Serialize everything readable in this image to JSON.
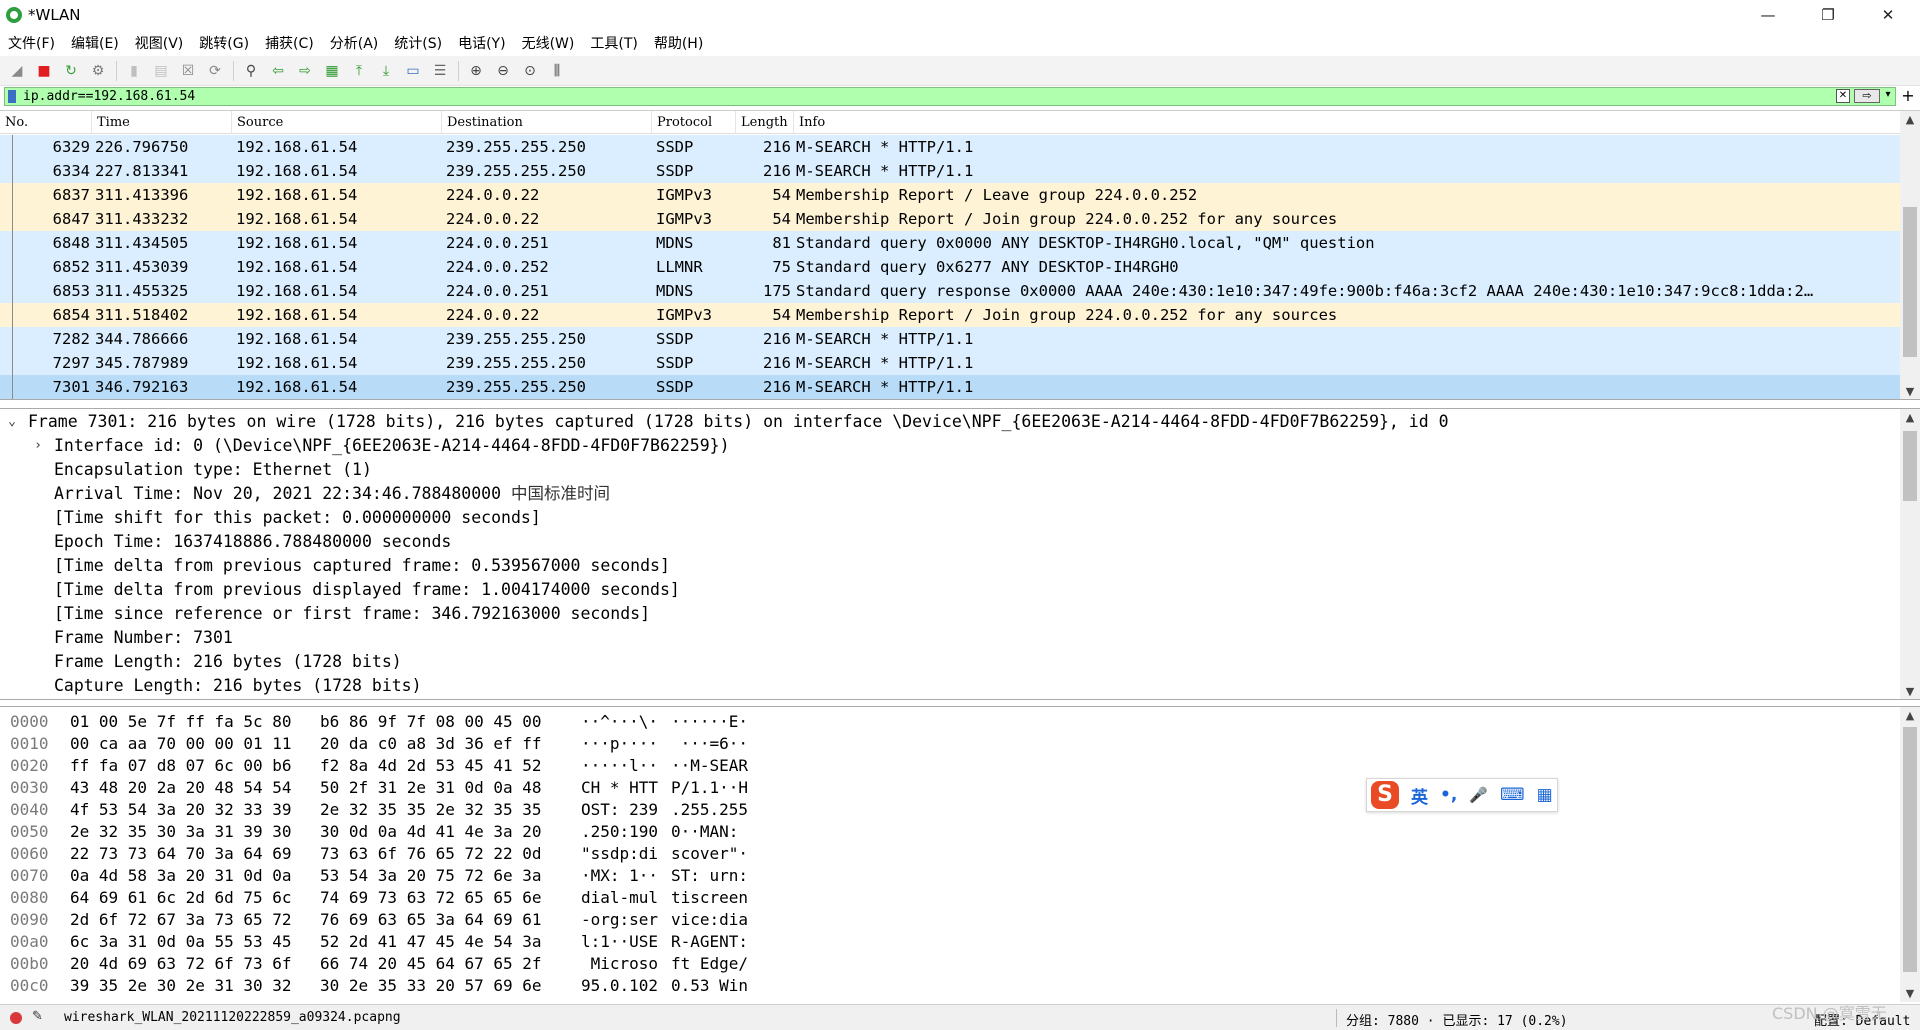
{
  "window": {
    "title": "*WLAN",
    "controls": {
      "minimize": "—",
      "maximize": "❐",
      "close": "✕"
    }
  },
  "menu": [
    "文件(F)",
    "编辑(E)",
    "视图(V)",
    "跳转(G)",
    "捕获(C)",
    "分析(A)",
    "统计(S)",
    "电话(Y)",
    "无线(W)",
    "工具(T)",
    "帮助(H)"
  ],
  "toolbar": [
    {
      "icon": "shark-fin-start-icon",
      "glyph": "◢",
      "color": "#8a8a8a"
    },
    {
      "icon": "stop-capture-icon",
      "glyph": "■",
      "color": "#e11d1d"
    },
    {
      "icon": "restart-capture-icon",
      "glyph": "↻",
      "color": "#3aa13a"
    },
    {
      "icon": "capture-options-icon",
      "glyph": "⚙",
      "color": "#777777"
    },
    {
      "icon": "open-file-icon",
      "glyph": "▮",
      "color": "#bfbfbf"
    },
    {
      "icon": "save-file-icon",
      "glyph": "▤",
      "color": "#bfbfbf"
    },
    {
      "icon": "close-file-icon",
      "glyph": "☒",
      "color": "#888888"
    },
    {
      "icon": "reload-file-icon",
      "glyph": "⟳",
      "color": "#888888"
    },
    {
      "icon": "find-packet-icon",
      "glyph": "⚲",
      "color": "#444444"
    },
    {
      "icon": "go-back-icon",
      "glyph": "⇦",
      "color": "#2f9a2f"
    },
    {
      "icon": "go-forward-icon",
      "glyph": "⇨",
      "color": "#2f9a2f"
    },
    {
      "icon": "go-to-packet-icon",
      "glyph": "▦",
      "color": "#2f9a2f"
    },
    {
      "icon": "first-packet-icon",
      "glyph": "⤒",
      "color": "#2f9a2f"
    },
    {
      "icon": "last-packet-icon",
      "glyph": "⤓",
      "color": "#2f9a2f"
    },
    {
      "icon": "autoscroll-icon",
      "glyph": "▭",
      "color": "#3a6fc4"
    },
    {
      "icon": "colorize-icon",
      "glyph": "☰",
      "color": "#666666"
    },
    {
      "icon": "zoom-in-icon",
      "glyph": "⊕",
      "color": "#444444"
    },
    {
      "icon": "zoom-out-icon",
      "glyph": "⊖",
      "color": "#444444"
    },
    {
      "icon": "zoom-normal-icon",
      "glyph": "⊙",
      "color": "#444444"
    },
    {
      "icon": "resize-columns-icon",
      "glyph": "⫼",
      "color": "#444444"
    }
  ],
  "filter": {
    "value": "ip.addr==192.168.61.54",
    "clear_glyph": "✕",
    "apply_glyph": "⇨",
    "dropdown_glyph": "▾",
    "add_glyph": "+",
    "bg_color": "#afffaf"
  },
  "packet_list": {
    "columns": [
      "No.",
      "Time",
      "Source",
      "Destination",
      "Protocol",
      "Length",
      "Info"
    ],
    "colors": {
      "ssdp": "#daeeff",
      "igmp": "#fff3d6",
      "selected": "#b8dcf8"
    },
    "rows": [
      {
        "no": "6329",
        "time": "226.796750",
        "src": "192.168.61.54",
        "dst": "239.255.255.250",
        "proto": "SSDP",
        "len": "216",
        "info": "M-SEARCH * HTTP/1.1",
        "color": "#daeeff"
      },
      {
        "no": "6334",
        "time": "227.813341",
        "src": "192.168.61.54",
        "dst": "239.255.255.250",
        "proto": "SSDP",
        "len": "216",
        "info": "M-SEARCH * HTTP/1.1",
        "color": "#daeeff"
      },
      {
        "no": "6837",
        "time": "311.413396",
        "src": "192.168.61.54",
        "dst": "224.0.0.22",
        "proto": "IGMPv3",
        "len": "54",
        "info": "Membership Report / Leave group 224.0.0.252",
        "color": "#fff3d6"
      },
      {
        "no": "6847",
        "time": "311.433232",
        "src": "192.168.61.54",
        "dst": "224.0.0.22",
        "proto": "IGMPv3",
        "len": "54",
        "info": "Membership Report / Join group 224.0.0.252 for any sources",
        "color": "#fff3d6"
      },
      {
        "no": "6848",
        "time": "311.434505",
        "src": "192.168.61.54",
        "dst": "224.0.0.251",
        "proto": "MDNS",
        "len": "81",
        "info": "Standard query 0x0000 ANY DESKTOP-IH4RGH0.local, \"QM\" question",
        "color": "#daeeff"
      },
      {
        "no": "6852",
        "time": "311.453039",
        "src": "192.168.61.54",
        "dst": "224.0.0.252",
        "proto": "LLMNR",
        "len": "75",
        "info": "Standard query 0x6277 ANY DESKTOP-IH4RGH0",
        "color": "#daeeff"
      },
      {
        "no": "6853",
        "time": "311.455325",
        "src": "192.168.61.54",
        "dst": "224.0.0.251",
        "proto": "MDNS",
        "len": "175",
        "info": "Standard query response 0x0000 AAAA 240e:430:1e10:347:49fe:900b:f46a:3cf2 AAAA 240e:430:1e10:347:9cc8:1dda:2…",
        "color": "#daeeff"
      },
      {
        "no": "6854",
        "time": "311.518402",
        "src": "192.168.61.54",
        "dst": "224.0.0.22",
        "proto": "IGMPv3",
        "len": "54",
        "info": "Membership Report / Join group 224.0.0.252 for any sources",
        "color": "#fff3d6"
      },
      {
        "no": "7282",
        "time": "344.786666",
        "src": "192.168.61.54",
        "dst": "239.255.255.250",
        "proto": "SSDP",
        "len": "216",
        "info": "M-SEARCH * HTTP/1.1",
        "color": "#daeeff"
      },
      {
        "no": "7297",
        "time": "345.787989",
        "src": "192.168.61.54",
        "dst": "239.255.255.250",
        "proto": "SSDP",
        "len": "216",
        "info": "M-SEARCH * HTTP/1.1",
        "color": "#daeeff"
      },
      {
        "no": "7301",
        "time": "346.792163",
        "src": "192.168.61.54",
        "dst": "239.255.255.250",
        "proto": "SSDP",
        "len": "216",
        "info": "M-SEARCH * HTTP/1.1",
        "color": "#b8dcf8"
      }
    ]
  },
  "details": {
    "lines": [
      {
        "expander": "⌄",
        "text": "Frame 7301: 216 bytes on wire (1728 bits), 216 bytes captured (1728 bits) on interface \\Device\\NPF_{6EE2063E-A214-4464-8FDD-4FD0F7B62259}, id 0",
        "cn": ""
      },
      {
        "expander": "›",
        "text": "Interface id: 0 (\\Device\\NPF_{6EE2063E-A214-4464-8FDD-4FD0F7B62259})",
        "cn": ""
      },
      {
        "expander": "",
        "text": "Encapsulation type: Ethernet (1)",
        "cn": ""
      },
      {
        "expander": "",
        "text": "Arrival Time: Nov 20, 2021 22:34:46.788480000 ",
        "cn": "中国标准时间"
      },
      {
        "expander": "",
        "text": "[Time shift for this packet: 0.000000000 seconds]",
        "cn": ""
      },
      {
        "expander": "",
        "text": "Epoch Time: 1637418886.788480000 seconds",
        "cn": ""
      },
      {
        "expander": "",
        "text": "[Time delta from previous captured frame: 0.539567000 seconds]",
        "cn": ""
      },
      {
        "expander": "",
        "text": "[Time delta from previous displayed frame: 1.004174000 seconds]",
        "cn": ""
      },
      {
        "expander": "",
        "text": "[Time since reference or first frame: 346.792163000 seconds]",
        "cn": ""
      },
      {
        "expander": "",
        "text": "Frame Number: 7301",
        "cn": ""
      },
      {
        "expander": "",
        "text": "Frame Length: 216 bytes (1728 bits)",
        "cn": ""
      },
      {
        "expander": "",
        "text": "Capture Length: 216 bytes (1728 bits)",
        "cn": ""
      }
    ]
  },
  "bytes": {
    "rows": [
      {
        "off": "0000",
        "h1": "01 00 5e 7f ff fa 5c 80",
        "h2": "b6 86 9f 7f 08 00 45 00",
        "a1": "··^···\\·",
        "a2": "······E·"
      },
      {
        "off": "0010",
        "h1": "00 ca aa 70 00 00 01 11",
        "h2": "20 da c0 a8 3d 36 ef ff",
        "a1": "···p····",
        "a2": " ···=6··"
      },
      {
        "off": "0020",
        "h1": "ff fa 07 d8 07 6c 00 b6",
        "h2": "f2 8a 4d 2d 53 45 41 52",
        "a1": "·····l··",
        "a2": "··M-SEAR"
      },
      {
        "off": "0030",
        "h1": "43 48 20 2a 20 48 54 54",
        "h2": "50 2f 31 2e 31 0d 0a 48",
        "a1": "CH * HTT",
        "a2": "P/1.1··H"
      },
      {
        "off": "0040",
        "h1": "4f 53 54 3a 20 32 33 39",
        "h2": "2e 32 35 35 2e 32 35 35",
        "a1": "OST: 239",
        "a2": ".255.255"
      },
      {
        "off": "0050",
        "h1": "2e 32 35 30 3a 31 39 30",
        "h2": "30 0d 0a 4d 41 4e 3a 20",
        "a1": ".250:190",
        "a2": "0··MAN: "
      },
      {
        "off": "0060",
        "h1": "22 73 73 64 70 3a 64 69",
        "h2": "73 63 6f 76 65 72 22 0d",
        "a1": "\"ssdp:di",
        "a2": "scover\"·"
      },
      {
        "off": "0070",
        "h1": "0a 4d 58 3a 20 31 0d 0a",
        "h2": "53 54 3a 20 75 72 6e 3a",
        "a1": "·MX: 1··",
        "a2": "ST: urn:"
      },
      {
        "off": "0080",
        "h1": "64 69 61 6c 2d 6d 75 6c",
        "h2": "74 69 73 63 72 65 65 6e",
        "a1": "dial-mul",
        "a2": "tiscreen"
      },
      {
        "off": "0090",
        "h1": "2d 6f 72 67 3a 73 65 72",
        "h2": "76 69 63 65 3a 64 69 61",
        "a1": "-org:ser",
        "a2": "vice:dia"
      },
      {
        "off": "00a0",
        "h1": "6c 3a 31 0d 0a 55 53 45",
        "h2": "52 2d 41 47 45 4e 54 3a",
        "a1": "l:1··USE",
        "a2": "R-AGENT:"
      },
      {
        "off": "00b0",
        "h1": "20 4d 69 63 72 6f 73 6f",
        "h2": "66 74 20 45 64 67 65 2f",
        "a1": " Microso",
        "a2": "ft Edge/"
      },
      {
        "off": "00c0",
        "h1": "39 35 2e 30 2e 31 30 32",
        "h2": "30 2e 35 33 20 57 69 6e",
        "a1": "95.0.102",
        "a2": "0.53 Win"
      }
    ]
  },
  "ime": {
    "logo": "S",
    "lang": "英",
    "punct": "•,",
    "mic": "🎤",
    "keyboard": "⌨",
    "apps": "▦"
  },
  "status": {
    "file": "wireshark_WLAN_20211120222859_a09324.pcapng",
    "packets": "分组: 7880 · 已显示: 17 (0.2%)",
    "profile": "配置: Default",
    "watermark": "CSDN @寞雪无"
  }
}
